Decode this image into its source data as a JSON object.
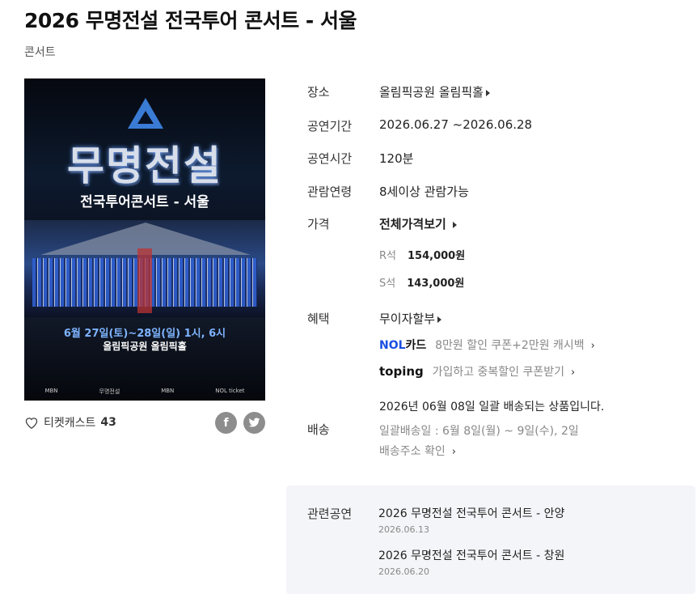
{
  "title": "2026 무명전설 전국투어 콘서트 - 서울",
  "genre": "콘서트",
  "poster": {
    "logo": "무명전설",
    "subtitle": "전국투어콘서트 - 서울",
    "date_text": "6월 27일(토)~28일(일) 1시, 6시",
    "venue_text": "올림픽공원 올림픽홀",
    "sponsors": [
      "MBN",
      "무명전설",
      "MBN",
      "NOL ticket"
    ]
  },
  "like": {
    "label": "티켓캐스트",
    "count": "43"
  },
  "share": {
    "facebook": "f",
    "twitter": "t"
  },
  "info": {
    "venue_label": "장소",
    "venue_value": "올림픽공원 올림픽홀",
    "period_label": "공연기간",
    "period_value": "2026.06.27 ~2026.06.28",
    "runtime_label": "공연시간",
    "runtime_value": "120분",
    "age_label": "관람연령",
    "age_value": "8세이상 관람가능",
    "price_label": "가격",
    "price_all": "전체가격보기",
    "prices": [
      {
        "seat": "R석",
        "price": "154,000원"
      },
      {
        "seat": "S석",
        "price": "143,000원"
      }
    ],
    "benefit_label": "혜택",
    "benefit_value": "무이자할부",
    "nol_brand": "NOL",
    "nol_card": "카드",
    "nol_text": "8만원 할인 쿠폰+2만원 캐시백",
    "toping_brand": "toping",
    "toping_text": "가입하고 중복할인 쿠폰받기",
    "delivery_label": "배송",
    "delivery_line1": "2026년 06월 08일 일괄 배송되는 상품입니다.",
    "delivery_line2": "일괄배송일 : 6월 8일(월) ~ 9일(수), 2일",
    "delivery_line3": "배송주소 확인"
  },
  "related": {
    "label": "관련공연",
    "items": [
      {
        "name": "2026 무명전설 전국투어 콘서트 - 안양",
        "date": "2026.06.13"
      },
      {
        "name": "2026 무명전설 전국투어 콘서트 - 창원",
        "date": "2026.06.20"
      }
    ]
  }
}
